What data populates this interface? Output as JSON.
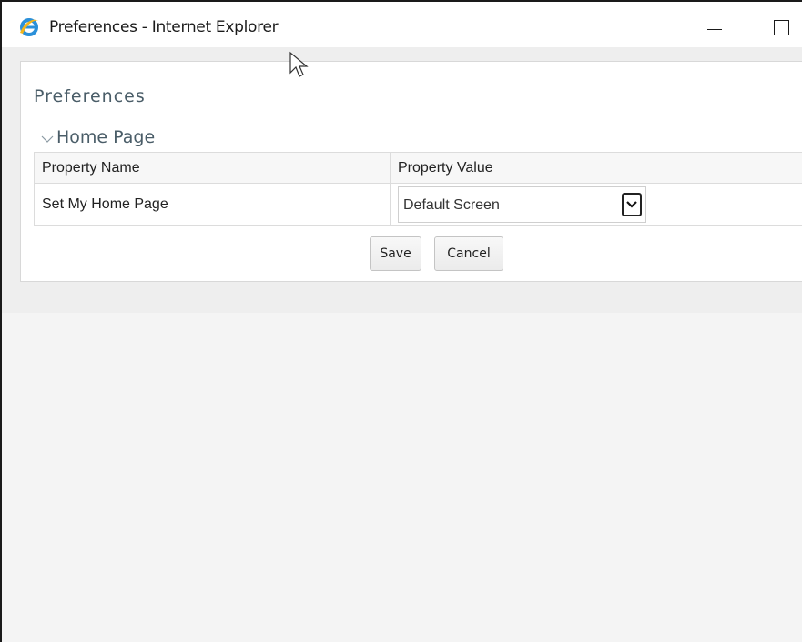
{
  "window": {
    "title": "Preferences - Internet Explorer",
    "icon": "ie-icon",
    "controls": [
      "minimize",
      "maximize"
    ]
  },
  "page": {
    "title": "Preferences",
    "section": {
      "title": "Home Page",
      "expanded": true
    },
    "table": {
      "columns": [
        "Property Name",
        "Property Value",
        ""
      ],
      "rows": [
        {
          "name": "Set My Home Page",
          "value": "Default Screen"
        }
      ]
    },
    "buttons": {
      "save": "Save",
      "cancel": "Cancel"
    }
  },
  "colors": {
    "heading": "#4a5d68",
    "background": "#f4f4f4",
    "panel": "#ffffff"
  }
}
